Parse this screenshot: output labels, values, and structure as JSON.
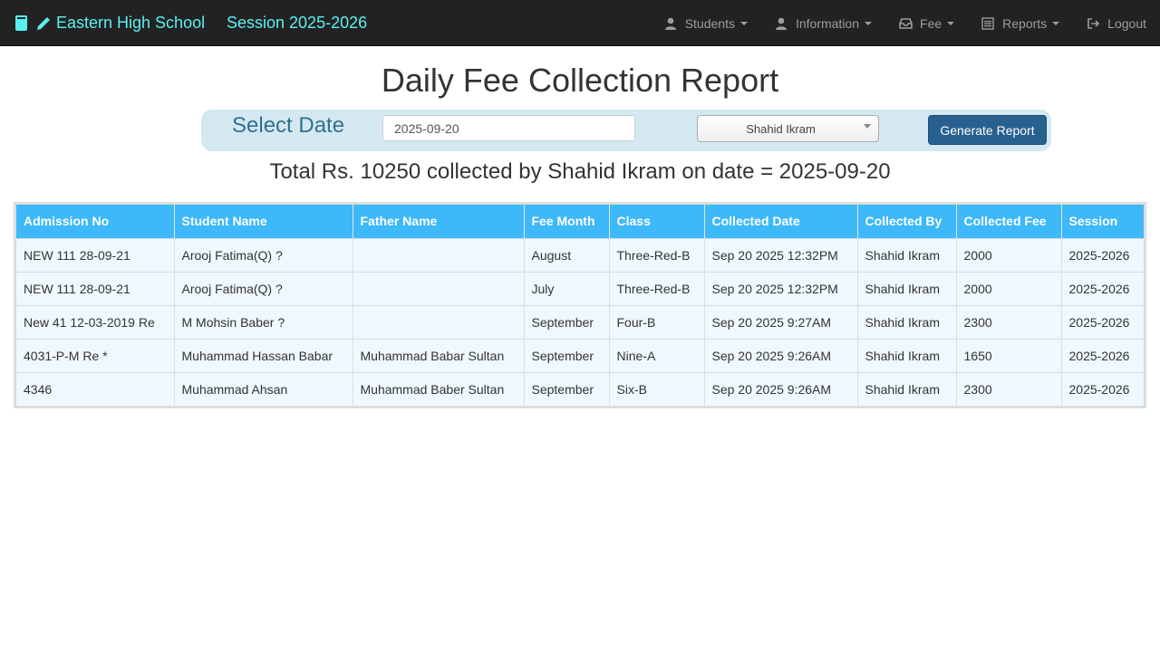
{
  "navbar": {
    "brand_title": "Eastern High School",
    "session_label": "Session 2025-2026",
    "items": [
      {
        "label": "Students",
        "icon": "user-icon"
      },
      {
        "label": "Information",
        "icon": "user-icon"
      },
      {
        "label": "Fee",
        "icon": "inbox-icon"
      },
      {
        "label": "Reports",
        "icon": "list-icon"
      },
      {
        "label": "Logout",
        "icon": "logout-icon"
      }
    ]
  },
  "page": {
    "title": "Daily Fee Collection Report"
  },
  "filter": {
    "select_date_label": "Select Date",
    "date_value": "2025-09-20",
    "collector_selected": "Shahid Ikram",
    "generate_label": "Generate Report"
  },
  "summary": {
    "text": "Total Rs. 10250 collected by Shahid Ikram on date = 2025-09-20"
  },
  "table": {
    "headers": [
      "Admission No",
      "Student Name",
      "Father Name",
      "Fee Month",
      "Class",
      "Collected Date",
      "Collected By",
      "Collected Fee",
      "Session"
    ],
    "rows": [
      [
        "NEW 111 28-09-21",
        "Arooj Fatima(Q) ?",
        "",
        "August",
        "Three-Red-B",
        "Sep 20 2025 12:32PM",
        "Shahid Ikram",
        "2000",
        "2025-2026"
      ],
      [
        "NEW 111 28-09-21",
        "Arooj Fatima(Q) ?",
        "",
        "July",
        "Three-Red-B",
        "Sep 20 2025 12:32PM",
        "Shahid Ikram",
        "2000",
        "2025-2026"
      ],
      [
        "New 41 12-03-2019 Re",
        "M Mohsin Baber ?",
        "",
        "September",
        "Four-B",
        "Sep 20 2025 9:27AM",
        "Shahid Ikram",
        "2300",
        "2025-2026"
      ],
      [
        "4031-P-M Re *",
        "Muhammad Hassan Babar",
        "Muhammad Babar Sultan",
        "September",
        "Nine-A",
        "Sep 20 2025 9:26AM",
        "Shahid Ikram",
        "1650",
        "2025-2026"
      ],
      [
        "4346",
        "Muhammad Ahsan",
        "Muhammad Baber Sultan",
        "September",
        "Six-B",
        "Sep 20 2025 9:26AM",
        "Shahid Ikram",
        "2300",
        "2025-2026"
      ]
    ]
  },
  "colors": {
    "navbar_bg": "#222222",
    "brand": "#5bf0f0",
    "table_header": "#3db8f8",
    "row_bg": "#eef8fe",
    "filter_bg": "#d3e8f1",
    "button": "#286090"
  }
}
